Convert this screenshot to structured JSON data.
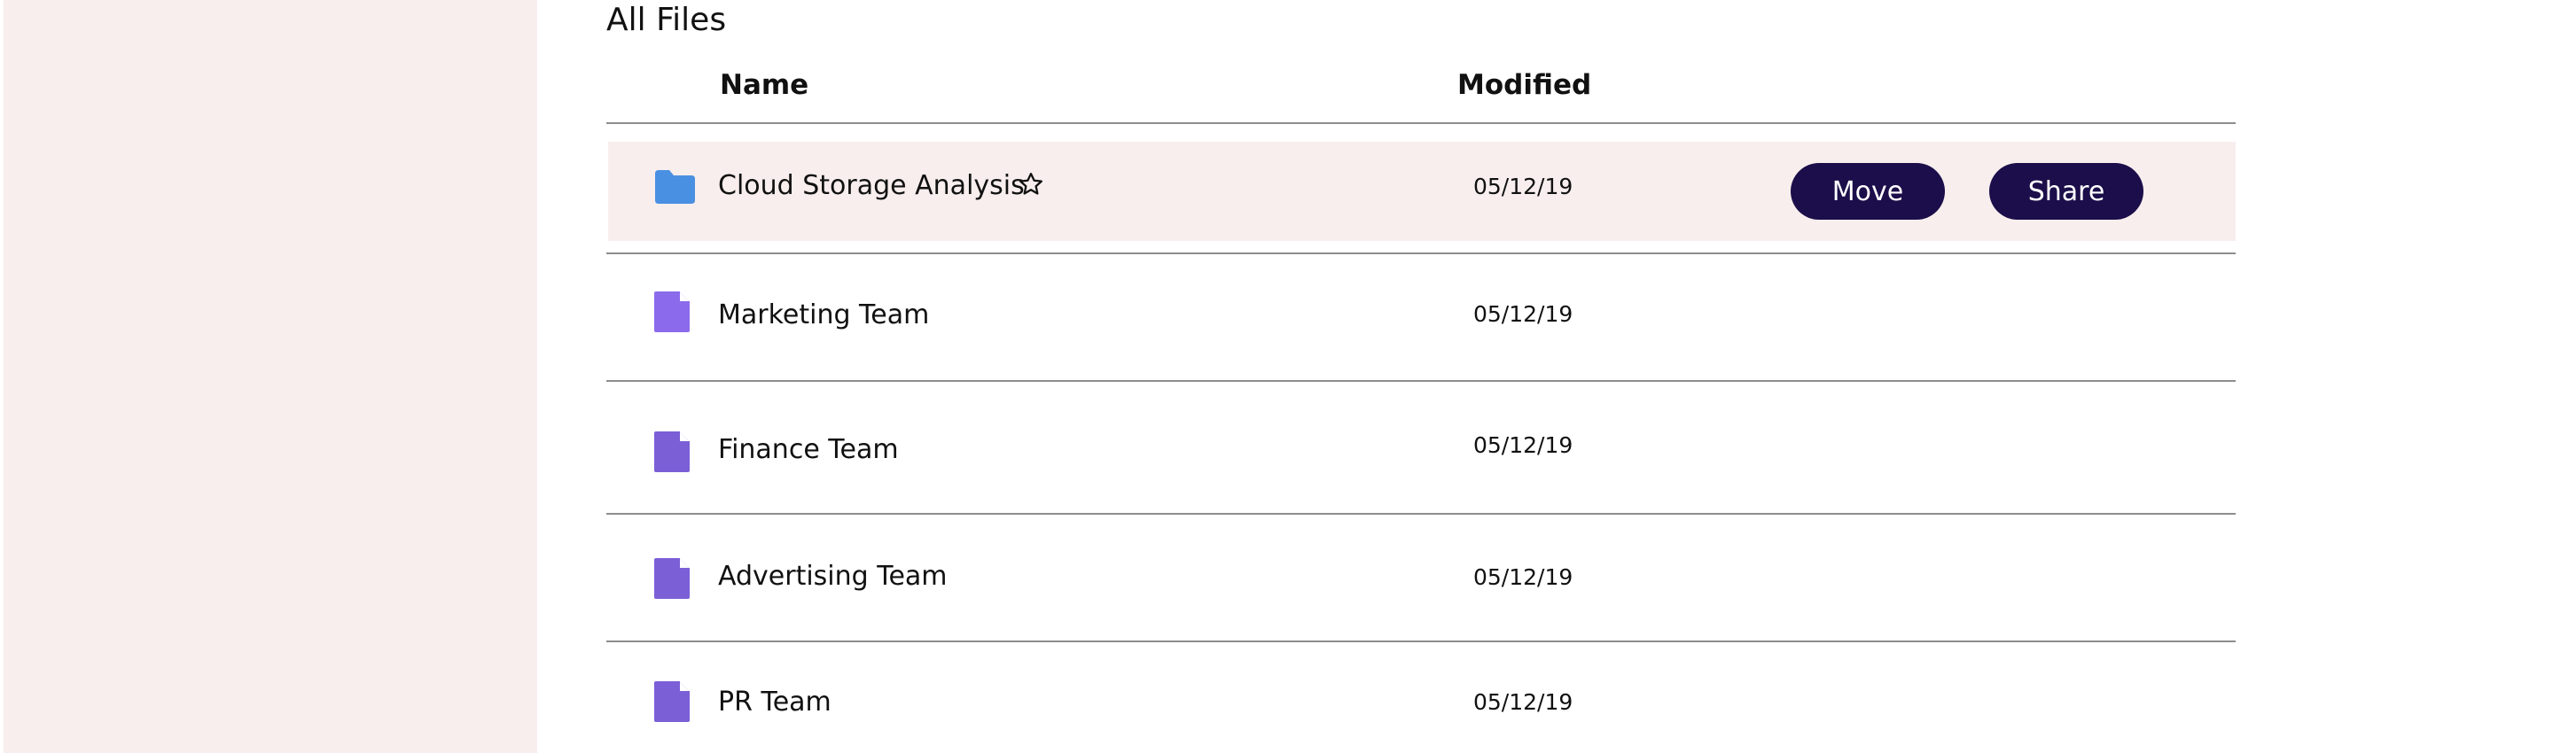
{
  "section_title": "All Files",
  "columns": {
    "name": "Name",
    "modified": "Modified"
  },
  "rows": [
    {
      "name": "Cloud Storage Analysis",
      "modified": "05/12/19",
      "icon": "folder-icon",
      "icon_color": "#4a90e2",
      "starred": false,
      "selected": true
    },
    {
      "name": "Marketing Team",
      "modified": "05/12/19",
      "icon": "document-icon",
      "icon_color": "#8b6bec",
      "selected": false
    },
    {
      "name": "Finance Team",
      "modified": "05/12/19",
      "icon": "document-icon",
      "icon_color": "#7b5fd6",
      "selected": false
    },
    {
      "name": "Advertising Team",
      "modified": "05/12/19",
      "icon": "document-icon",
      "icon_color": "#7b5fd6",
      "selected": false
    },
    {
      "name": "PR Team",
      "modified": "05/12/19",
      "icon": "document-icon",
      "icon_color": "#7b5fd6",
      "selected": false
    }
  ],
  "actions": {
    "move_label": "Move",
    "share_label": "Share"
  },
  "colors": {
    "sidebar_bg": "#f8eeed",
    "selected_row_bg": "#f8eeed",
    "button_bg": "#1b0e4a",
    "button_text": "#ffffff",
    "divider": "#8d8d8d"
  }
}
